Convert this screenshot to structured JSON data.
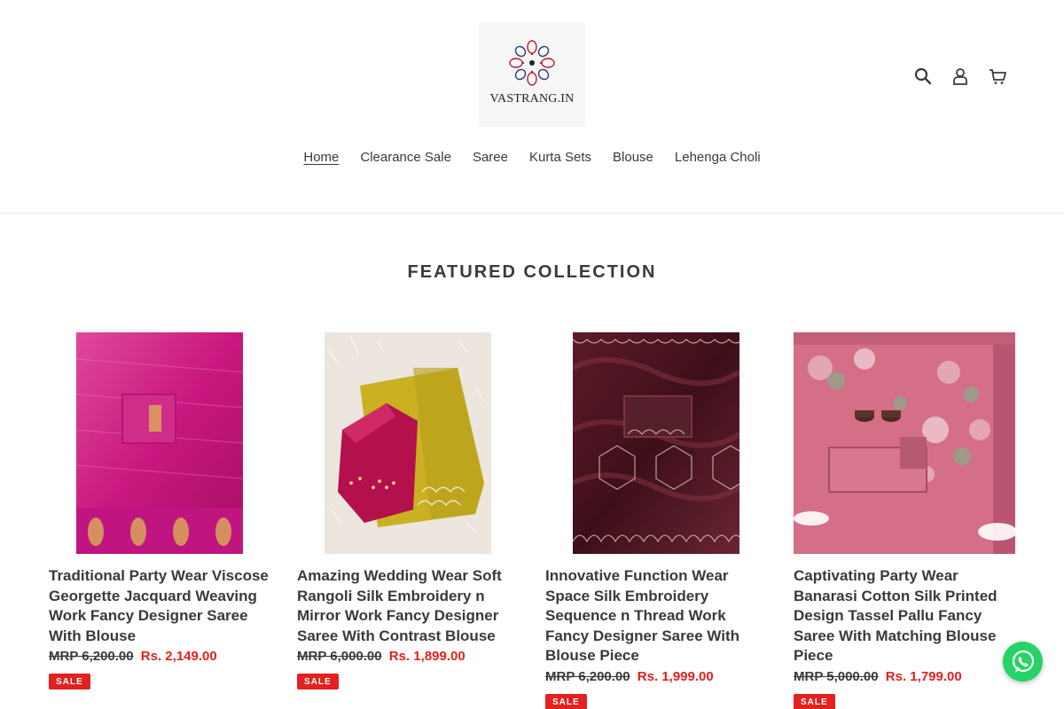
{
  "brand": {
    "logo_text": "VASTRANG.IN"
  },
  "header_icons": [
    {
      "name": "search-icon",
      "label": "Search"
    },
    {
      "name": "user-icon",
      "label": "Log in"
    },
    {
      "name": "cart-icon",
      "label": "Cart"
    }
  ],
  "nav": {
    "items": [
      {
        "label": "Home",
        "active": true
      },
      {
        "label": "Clearance Sale"
      },
      {
        "label": "Saree"
      },
      {
        "label": "Kurta Sets"
      },
      {
        "label": "Blouse"
      },
      {
        "label": "Lehenga Choli"
      }
    ]
  },
  "section": {
    "title": "FEATURED COLLECTION"
  },
  "products": [
    {
      "title": "Traditional Party Wear Viscose Georgette Jacquard Weaving Work Fancy Designer Saree With Blouse",
      "mrp": "MRP 6,200.00",
      "price": "Rs. 2,149.00",
      "badge": "SALE",
      "colors": {
        "base": "#c8177e",
        "accent": "#d9a55a"
      }
    },
    {
      "title": "Amazing Wedding Wear Soft Rangoli Silk Embroidery n Mirror Work Fancy Designer Saree With Contrast Blouse",
      "mrp": "MRP 6,000.00",
      "price": "Rs. 1,899.00",
      "badge": "SALE",
      "colors": {
        "base": "#c9b122",
        "accent": "#b3104c"
      }
    },
    {
      "title": "Innovative Function Wear Space Silk Embroidery Sequence n Thread Work Fancy Designer Saree With Blouse Piece",
      "mrp": "MRP 6,200.00",
      "price": "Rs. 1,999.00",
      "badge": "SALE",
      "colors": {
        "base": "#4b1420",
        "accent": "#e8d8c8"
      }
    },
    {
      "title": "Captivating Party Wear Banarasi Cotton Silk Printed Design Tassel Pallu Fancy Saree With Matching Blouse Piece",
      "mrp": "MRP 5,000.00",
      "price": "Rs. 1,799.00",
      "badge": "SALE",
      "colors": {
        "base": "#d46f87",
        "accent": "#8fa68a"
      }
    }
  ],
  "colors": {
    "sale": "#e22120",
    "text": "#3a3a3a",
    "whatsapp": "#25d366"
  },
  "floating": {
    "icon": "whatsapp-icon"
  }
}
